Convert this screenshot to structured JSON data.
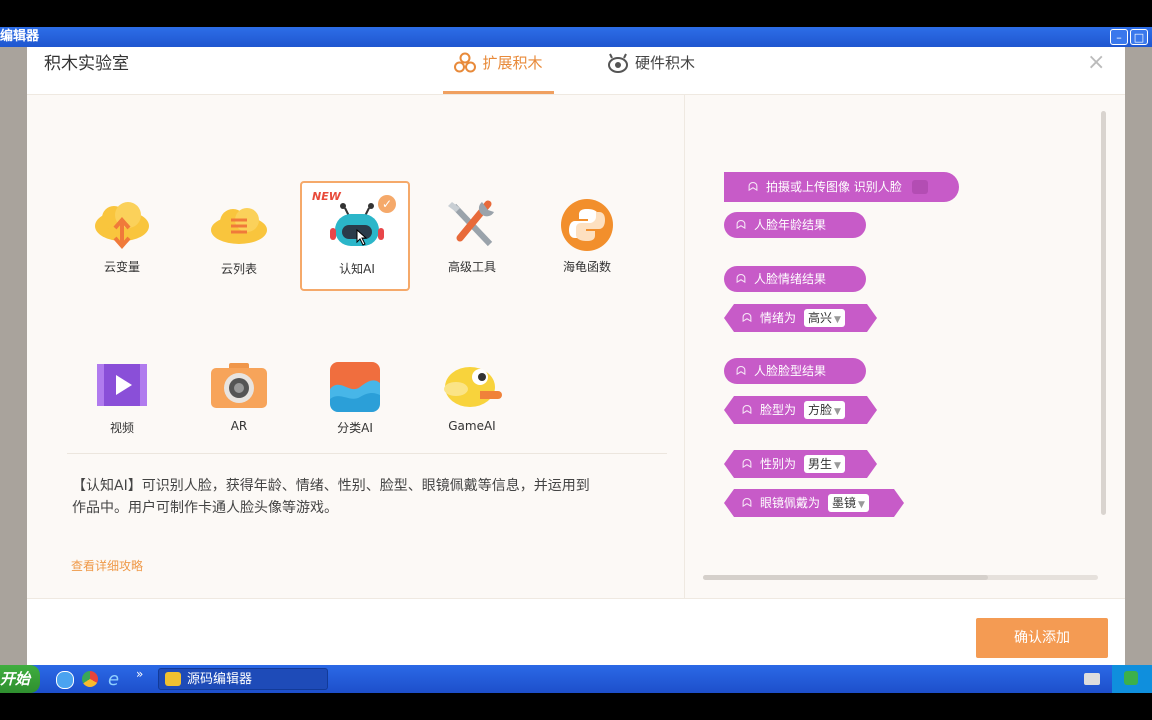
{
  "window": {
    "title": "编辑器",
    "btn_min": "–",
    "btn_max": "□"
  },
  "dialog": {
    "title": "积木实验室",
    "tabs": [
      {
        "label": "扩展积木",
        "active": true
      },
      {
        "label": "硬件积木",
        "active": false
      }
    ],
    "close": "×"
  },
  "extensions": [
    {
      "label": "云变量",
      "icon": "cloud-upload-icon"
    },
    {
      "label": "云列表",
      "icon": "cloud-list-icon"
    },
    {
      "label": "认知AI",
      "icon": "robot-icon",
      "badge": "NEW",
      "selected": true
    },
    {
      "label": "高级工具",
      "icon": "tools-icon"
    },
    {
      "label": "海龟函数",
      "icon": "python-icon"
    },
    {
      "label": "视频",
      "icon": "video-icon"
    },
    {
      "label": "AR",
      "icon": "camera-icon"
    },
    {
      "label": "分类AI",
      "icon": "classify-icon"
    },
    {
      "label": "GameAI",
      "icon": "bird-icon"
    }
  ],
  "description": {
    "line1": "【认知AI】可识别人脸，获得年龄、情绪、性别、脸型、眼镜佩戴等信息，并运用到",
    "line2": "作品中。用户可制作卡通人脸头像等游戏。"
  },
  "guide_link": "查看详细攻略",
  "blocks": [
    {
      "text": "拍摄或上传图像 识别人脸"
    },
    {
      "text": "人脸年龄结果"
    },
    {
      "text": "人脸情绪结果"
    },
    {
      "text": "情绪为",
      "value": "高兴"
    },
    {
      "text": "人脸脸型结果"
    },
    {
      "text": "脸型为",
      "value": "方脸"
    },
    {
      "text": "性别为",
      "value": "男生"
    },
    {
      "text": "眼镜佩戴为",
      "value": "墨镜"
    }
  ],
  "confirm_button": "确认添加",
  "taskbar": {
    "start": "开始",
    "task": "源码编辑器"
  },
  "colors": {
    "accent": "#f49b53",
    "block": "#c75bc8",
    "titlebar": "#2d6ee8"
  }
}
